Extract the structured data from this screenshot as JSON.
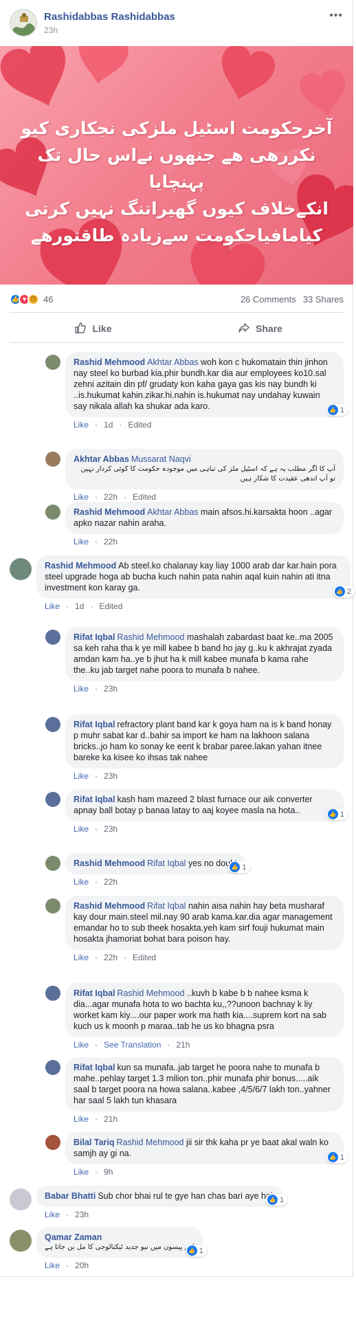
{
  "post": {
    "author": "Rashidabbas Rashidabbas",
    "time": "23h",
    "menu": "•••",
    "image_text_lines": [
      "آخرحکومت اسٹیل ملزکی نجکاری کیو",
      "نکررھی ھے جنھوں نےاس حال تک پہنچایا",
      "انکےخلاف کیوں گھیراتنگ نہیں کرتی",
      "کیامافیاحکومت سےزیادہ طاقتورھے"
    ]
  },
  "reactions": {
    "count": "46",
    "comments": "26 Comments",
    "shares": "33 Shares"
  },
  "actions": {
    "like": "Like",
    "share": "Share"
  },
  "comments": [
    {
      "name": "Rashid Mehmood",
      "tag": "Akhtar Abbas",
      "text": "woh kon c hukomatain thin jinhon nay steel ko burbad kia.phir bundh.kar dia aur employees ko10.sal zehni azitain din pf/ grudaty kon kaha gaya gas kis nay bundh ki ..is.hukumat kahin.zikar.hi.nahin is.hukumat nay undahay kuwain say nikala allah ka shukar ada karo.",
      "meta": [
        "Like",
        "1d",
        "Edited"
      ],
      "likes": "1"
    },
    {
      "name": "Akhtar Abbas",
      "tag": "Mussarat Naqvi",
      "text": "آپ کا اگر مطلب یہ ہے کہ اسٹیل ملز کی تباہی میں موجودہ حکومت کا کوئی کردار نہیں تو آپ اندھی عقیدت کا شکار ہیں",
      "meta": [
        "Like",
        "22h",
        "Edited"
      ],
      "likes": ""
    },
    {
      "name": "Rashid Mehmood",
      "tag": "Akhtar Abbas",
      "text": "main afsos.hi.karsakta hoon ..agar apko nazar nahin araha.",
      "meta": [
        "Like",
        "22h"
      ],
      "likes": ""
    },
    {
      "name": "Rashid Mehmood",
      "tag": "",
      "text": "Ab steel.ko chalanay kay liay 1000 arab dar kar.hain pora steel upgrade hoga ab bucha kuch nahin pata nahin aqal kuin nahin ati itna investment kon karay ga.",
      "meta": [
        "Like",
        "1d",
        "Edited"
      ],
      "likes": "2"
    },
    {
      "name": "Rifat Iqbal",
      "tag": "Rashid Mehmood",
      "text": "mashalah zabardast baat ke..ma 2005 sa keh raha tha k ye mill kabee b band ho jay g..ku k akhrajat zyada amdan kam ha..ye b jhut ha k mill kabee munafa b kama rahe the..ku jab target nahe poora to munafa b nahee.",
      "meta": [
        "Like",
        "23h"
      ],
      "likes": ""
    },
    {
      "name": "Rifat Iqbal",
      "tag": "",
      "text": "refractory plant band kar k goya ham na is k band honay p muhr sabat kar d..bahir sa import ke ham na lakhoon salana bricks..jo ham ko sonay ke eent k brabar paree.lakan yahan itnee bareke ka kisee ko ihsas tak nahee",
      "meta": [
        "Like",
        "23h"
      ],
      "likes": ""
    },
    {
      "name": "Rifat Iqbal",
      "tag": "",
      "text": "kash ham mazeed 2 blast furnace our aik converter apnay ball botay p banaa latay to aaj koyee masla na hota..",
      "meta": [
        "Like",
        "23h"
      ],
      "likes": "1"
    },
    {
      "name": "Rashid Mehmood",
      "tag": "Rifat Iqbal",
      "text": "yes no doubt",
      "meta": [
        "Like",
        "22h"
      ],
      "likes": "1"
    },
    {
      "name": "Rashid Mehmood",
      "tag": "Rifat Iqbal",
      "text": "nahin aisa nahin hay beta musharaf kay dour main.steel mil.nay 90 arab kama.kar.dia agar management emandar ho to sub theek hosakta.yeh kam sirf fouji hukumat main hosakta jhamoriat bohat bara poison hay.",
      "meta": [
        "Like",
        "22h",
        "Edited"
      ],
      "likes": ""
    },
    {
      "name": "Rifat Iqbal",
      "tag": "Rashid Mehmood",
      "text": "..kuvh b kabe b b nahee ksma k dia...agar munafa hota to wo bachta ku,,??unoon bachnay k liy worket kam kiy....our paper work ma hath kia....suprem kort na sab kuch us k moonh p maraa..tab he us ko bhagna psra",
      "meta": [
        "Like",
        "See Translation",
        "21h"
      ],
      "likes": ""
    },
    {
      "name": "Rifat Iqbal",
      "tag": "",
      "text": "kun sa munafa..jab target he poora nahe to munafa b mahe..pehlay target 1.3 milion ton..phir munafa phir bonus.....aik saal b target poora na howa salana..kabee ,4/5/6/7 lakh ton..yahner har saal 5 lakh tun khasara",
      "meta": [
        "Like",
        "21h"
      ],
      "likes": ""
    },
    {
      "name": "Bilal Tariq",
      "tag": "Rashid Mehmood",
      "text": "jii sir thk kaha pr ye baat akal waln ko samjh ay gi na.",
      "meta": [
        "Like",
        "9h"
      ],
      "likes": "1"
    },
    {
      "name": "Babar Bhatti",
      "tag": "",
      "text": "Sub chor bhai rul te gye han chas bari aye hai.",
      "meta": [
        "Like",
        "23h"
      ],
      "likes": "1"
    },
    {
      "name": "Qamar Zaman",
      "tag": "",
      "text": "اتنے پیسوں میں نیو جدید ٹیکنالوجی کا مل بن جاتا ہے",
      "meta": [
        "Like",
        "20h"
      ],
      "likes": "1"
    }
  ]
}
